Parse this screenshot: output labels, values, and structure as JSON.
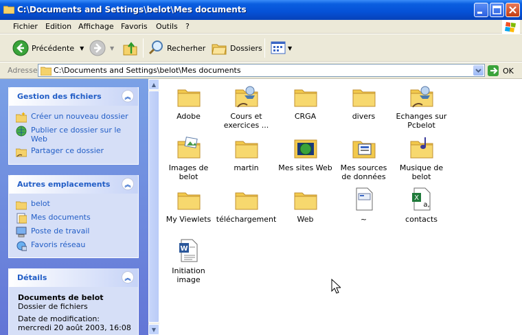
{
  "window": {
    "title": "C:\\Documents and Settings\\belot\\Mes documents"
  },
  "menu": [
    "Fichier",
    "Edition",
    "Affichage",
    "Favoris",
    "Outils",
    "?"
  ],
  "toolbar": {
    "back": "Précédente",
    "search": "Recherher",
    "folders": "Dossiers"
  },
  "address": {
    "label": "Adresse",
    "value": "C:\\Documents and Settings\\belot\\Mes documents",
    "go": "OK"
  },
  "panels": {
    "file_tasks": {
      "title": "Gestion des fichiers",
      "items": [
        "Créer un nouveau dossier",
        "Publier ce dossier sur le Web",
        "Partager ce dossier"
      ]
    },
    "other_places": {
      "title": "Autres emplacements",
      "items": [
        "belot",
        "Mes documents",
        "Poste de travail",
        "Favoris réseau"
      ]
    },
    "details": {
      "title": "Détails",
      "name": "Documents de belot",
      "type": "Dossier de fichiers",
      "modified": "Date de modification: mercredi 20 août 2003, 16:08"
    }
  },
  "files": [
    {
      "name": "Adobe",
      "icon": "folder-icon"
    },
    {
      "name": "Cours et exercices ...",
      "icon": "shared-folder-icon"
    },
    {
      "name": "CRGA",
      "icon": "folder-icon"
    },
    {
      "name": "divers",
      "icon": "folder-icon"
    },
    {
      "name": "Echanges sur Pcbelot",
      "icon": "shared-folder-icon"
    },
    {
      "name": "Images de belot",
      "icon": "pictures-folder-icon"
    },
    {
      "name": "martin",
      "icon": "folder-icon"
    },
    {
      "name": "Mes sites Web",
      "icon": "websites-folder-icon"
    },
    {
      "name": "Mes sources de données",
      "icon": "data-sources-folder-icon"
    },
    {
      "name": "Musique de belot",
      "icon": "music-folder-icon"
    },
    {
      "name": "My Viewlets",
      "icon": "folder-icon"
    },
    {
      "name": "téléchargement",
      "icon": "folder-icon"
    },
    {
      "name": "Web",
      "icon": "folder-icon"
    },
    {
      "name": "~",
      "icon": "file-icon"
    },
    {
      "name": "contacts",
      "icon": "excel-file-icon"
    },
    {
      "name": "Initiation image",
      "icon": "word-file-icon"
    }
  ]
}
